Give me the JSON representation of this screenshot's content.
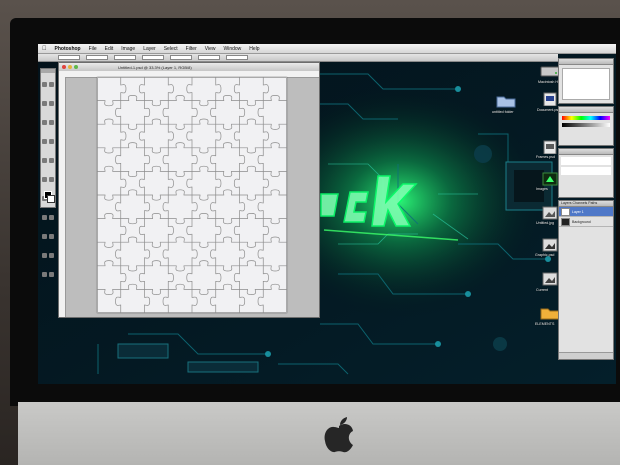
{
  "menubar": {
    "app_name": "Photoshop",
    "items": [
      "File",
      "Edit",
      "Image",
      "Layer",
      "Select",
      "Filter",
      "View",
      "Window",
      "Help"
    ]
  },
  "document": {
    "title": "Untitled-1.psd @ 33.3% (Layer 1, RGB/8)"
  },
  "desktop_icons": [
    {
      "label": "Macintosh HD",
      "icon": "hard-drive-icon"
    },
    {
      "label": "untitled folder",
      "icon": "folder-icon"
    },
    {
      "label": "Document.psd",
      "icon": "photoshop-file-icon"
    },
    {
      "label": "Frames.psd",
      "icon": "photoshop-file-icon"
    },
    {
      "label": "Images",
      "icon": "image-file-icon"
    },
    {
      "label": "Untitled.jpg",
      "icon": "image-file-icon"
    },
    {
      "label": "Graphic.psd",
      "icon": "photoshop-file-icon"
    },
    {
      "label": "Current",
      "icon": "image-file-icon"
    },
    {
      "label": "ELEMENTS",
      "icon": "folder-icon"
    }
  ],
  "layers_panel": {
    "tabs": [
      "Layers",
      "Channels",
      "Paths"
    ],
    "rows": [
      "Layer 1",
      "Background"
    ]
  },
  "colors": {
    "accent_green": "#3cff6a",
    "wallpaper_dark": "#02161d",
    "canvas": "#f1f1f3",
    "selection": "#4f78c8"
  }
}
